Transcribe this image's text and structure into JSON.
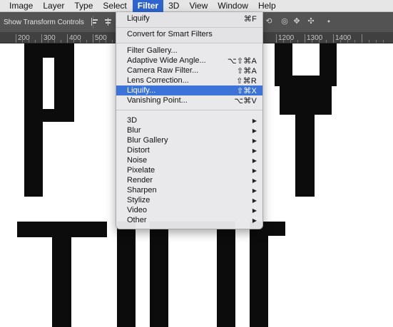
{
  "menubar": {
    "items": [
      {
        "label": "Image"
      },
      {
        "label": "Layer"
      },
      {
        "label": "Type"
      },
      {
        "label": "Select"
      },
      {
        "label": "Filter",
        "active": true
      },
      {
        "label": "3D"
      },
      {
        "label": "View"
      },
      {
        "label": "Window"
      },
      {
        "label": "Help"
      }
    ]
  },
  "options_bar": {
    "show_transform_controls_label": "Show Transform Controls"
  },
  "ruler": {
    "left_labels": [
      "200",
      "300",
      "400",
      "500"
    ],
    "right_labels": [
      "1200",
      "1300",
      "1400"
    ]
  },
  "filter_menu": {
    "last_filter": {
      "label": "Liquify",
      "shortcut": "⌘F"
    },
    "convert": {
      "label": "Convert for Smart Filters"
    },
    "group1": [
      {
        "label": "Filter Gallery...",
        "shortcut": ""
      },
      {
        "label": "Adaptive Wide Angle...",
        "shortcut": "⌥⇧⌘A"
      },
      {
        "label": "Camera Raw Filter...",
        "shortcut": "⇧⌘A"
      },
      {
        "label": "Lens Correction...",
        "shortcut": "⇧⌘R"
      },
      {
        "label": "Liquify...",
        "shortcut": "⇧⌘X",
        "highlighted": true
      },
      {
        "label": "Vanishing Point...",
        "shortcut": "⌥⌘V"
      }
    ],
    "submenus": [
      {
        "label": "3D"
      },
      {
        "label": "Blur"
      },
      {
        "label": "Blur Gallery"
      },
      {
        "label": "Distort"
      },
      {
        "label": "Noise"
      },
      {
        "label": "Pixelate"
      },
      {
        "label": "Render"
      },
      {
        "label": "Sharpen"
      },
      {
        "label": "Stylize"
      },
      {
        "label": "Video"
      },
      {
        "label": "Other"
      }
    ],
    "submenu_arrow": "▶"
  },
  "colors": {
    "menu_highlight": "#3b73d9",
    "active_menu": "#2f64cf",
    "options_bar": "#535353",
    "ruler": "#404040",
    "artwork_text": "#0c0c0c"
  }
}
